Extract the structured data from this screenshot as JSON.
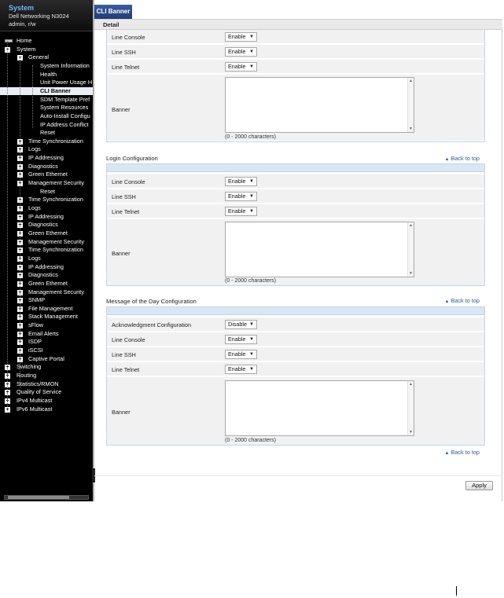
{
  "sidebar": {
    "title": "System",
    "device": "Dell Networking N3024",
    "user": "admin, r/w",
    "tree": [
      {
        "label": "Home",
        "toggle": "",
        "icon": "home-icon"
      },
      {
        "label": "System",
        "toggle": "−"
      },
      {
        "label": "General",
        "toggle": "−"
      },
      {
        "label": "System Information",
        "toggle": ""
      },
      {
        "label": "Health",
        "toggle": ""
      },
      {
        "label": "Unit Power Usage H",
        "toggle": ""
      },
      {
        "label": "CLI Banner",
        "toggle": "",
        "selected": true
      },
      {
        "label": "SDM Template Pref",
        "toggle": ""
      },
      {
        "label": "System Resources",
        "toggle": ""
      },
      {
        "label": "Auto-Install Configu",
        "toggle": ""
      },
      {
        "label": "IP Address Conflict",
        "toggle": ""
      },
      {
        "label": "Reset",
        "toggle": ""
      },
      {
        "label": "Time Synchronization",
        "toggle": "+"
      },
      {
        "label": "Logs",
        "toggle": "+"
      },
      {
        "label": "IP Addressing",
        "toggle": "+"
      },
      {
        "label": "Diagnostics",
        "toggle": "+"
      },
      {
        "label": "Green Ethernet",
        "toggle": "+"
      },
      {
        "label": "Management Security",
        "toggle": "+"
      },
      {
        "label": "Reset",
        "toggle": ""
      },
      {
        "label": "Time Synchronization",
        "toggle": "+"
      },
      {
        "label": "Logs",
        "toggle": "+"
      },
      {
        "label": "IP Addressing",
        "toggle": "+"
      },
      {
        "label": "Diagnostics",
        "toggle": "+"
      },
      {
        "label": "Green Ethernet",
        "toggle": "+"
      },
      {
        "label": "Management Security",
        "toggle": "+"
      },
      {
        "label": "Time Synchronization",
        "toggle": "+"
      },
      {
        "label": "Logs",
        "toggle": "+"
      },
      {
        "label": "IP Addressing",
        "toggle": "+"
      },
      {
        "label": "Diagnostics",
        "toggle": "+"
      },
      {
        "label": "Green Ethernet",
        "toggle": "+"
      },
      {
        "label": "Management Security",
        "toggle": "+"
      },
      {
        "label": "SNMP",
        "toggle": "+"
      },
      {
        "label": "File Management",
        "toggle": "+"
      },
      {
        "label": "Stack Management",
        "toggle": "+"
      },
      {
        "label": "sFlow",
        "toggle": "+"
      },
      {
        "label": "Email Alerts",
        "toggle": "+"
      },
      {
        "label": "ISDP",
        "toggle": "+"
      },
      {
        "label": "iSCSI",
        "toggle": "+"
      },
      {
        "label": "Captive Portal",
        "toggle": "+"
      },
      {
        "label": "Switching",
        "toggle": "+"
      },
      {
        "label": "Routing",
        "toggle": "+"
      },
      {
        "label": "Statistics/RMON",
        "toggle": "+"
      },
      {
        "label": "Quality of Service",
        "toggle": "+"
      },
      {
        "label": "IPv4 Multicast",
        "toggle": "+"
      },
      {
        "label": "IPv6 Multicast",
        "toggle": "+"
      }
    ]
  },
  "main": {
    "tab": "CLI Banner",
    "subtab": "Detail",
    "chars_hint": "(0 - 2000 characters)",
    "back_to_top": "Back to top",
    "banner_label": "Banner",
    "apply": "Apply",
    "section1": {
      "rows": [
        {
          "label": "Line Console",
          "value": "Enable"
        },
        {
          "label": "Line SSH",
          "value": "Enable"
        },
        {
          "label": "Line Telnet",
          "value": "Enable"
        }
      ]
    },
    "section2": {
      "title": "Login Configuration",
      "rows": [
        {
          "label": "Line Console",
          "value": "Enable"
        },
        {
          "label": "Line SSH",
          "value": "Enable"
        },
        {
          "label": "Line Telnet",
          "value": "Enable"
        }
      ]
    },
    "section3": {
      "title": "Message of the Day Configuration",
      "rows": [
        {
          "label": "Acknowledgment Configuration",
          "value": "Disable"
        },
        {
          "label": "Line Console",
          "value": "Enable"
        },
        {
          "label": "Line SSH",
          "value": "Enable"
        },
        {
          "label": "Line Telnet",
          "value": "Enable"
        }
      ]
    }
  }
}
